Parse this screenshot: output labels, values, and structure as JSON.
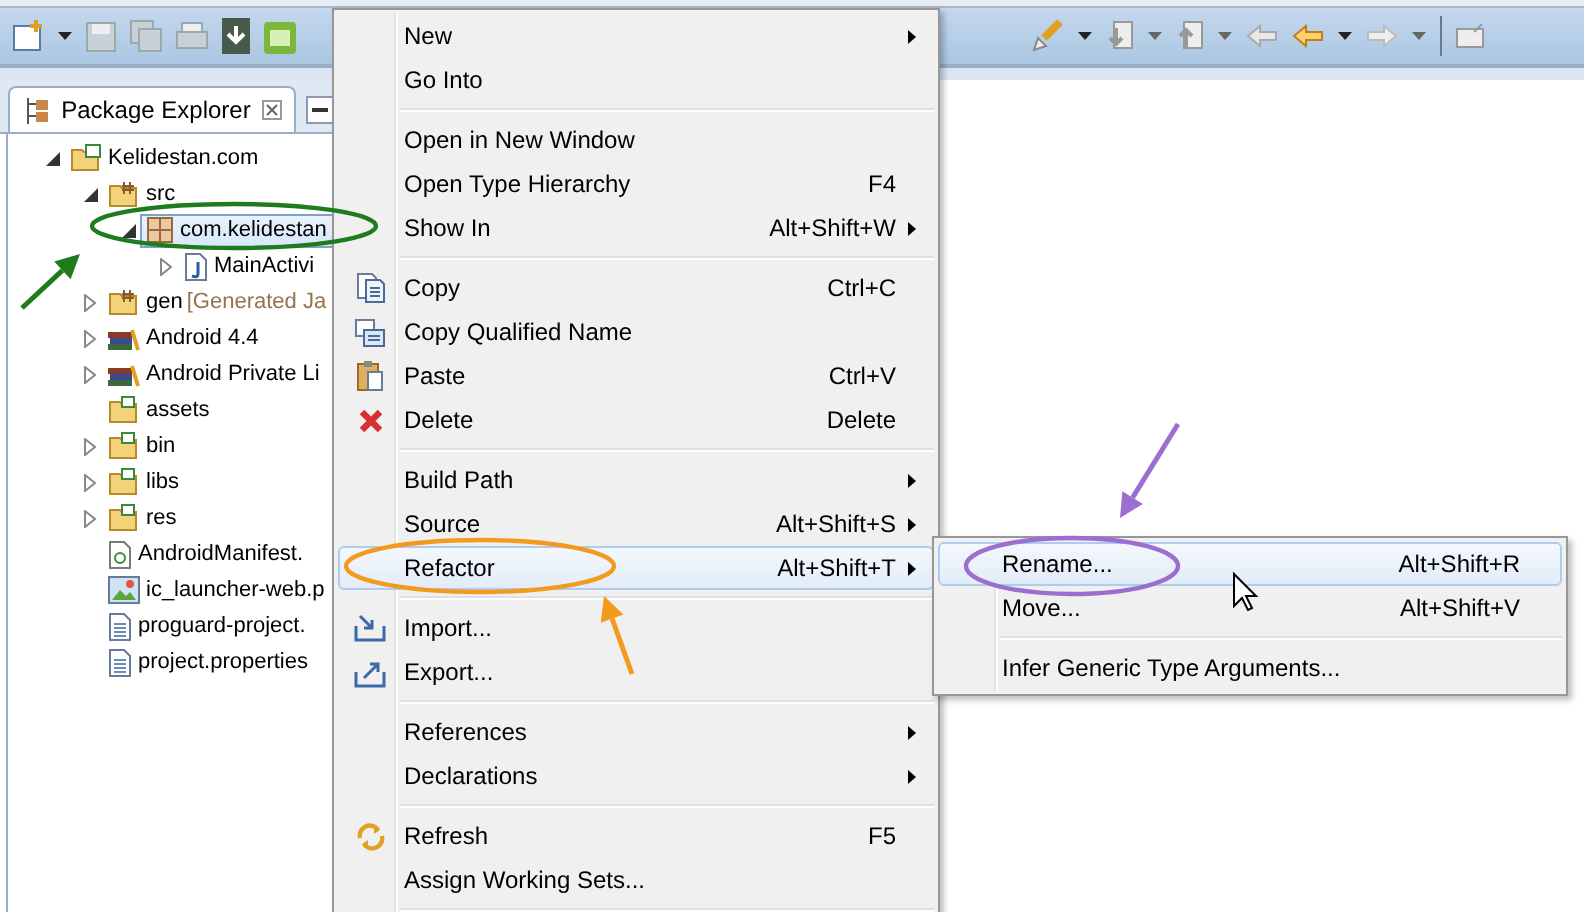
{
  "package_explorer": {
    "tab_label": "Package Explorer",
    "tree": [
      {
        "label": "Kelidestan.com",
        "kind": "project",
        "expandable": true,
        "expanded": true,
        "selected": false,
        "children": [
          {
            "label": "src",
            "kind": "source-folder",
            "expandable": true,
            "expanded": true,
            "selected": false,
            "children": [
              {
                "label": "com.kelidestan",
                "kind": "package",
                "expandable": true,
                "expanded": true,
                "selected": true,
                "children": [
                  {
                    "label": "MainActivi",
                    "kind": "java-file",
                    "expandable": true,
                    "expanded": false,
                    "selected": false
                  }
                ]
              }
            ]
          },
          {
            "label": "gen",
            "decoration": "[Generated Ja",
            "kind": "source-folder",
            "expandable": true,
            "expanded": false,
            "selected": false
          },
          {
            "label": "Android 4.4",
            "kind": "library",
            "expandable": true,
            "expanded": false,
            "selected": false
          },
          {
            "label": "Android Private Li",
            "kind": "library",
            "expandable": true,
            "expanded": false,
            "selected": false
          },
          {
            "label": "assets",
            "kind": "folder",
            "expandable": false,
            "selected": false
          },
          {
            "label": "bin",
            "kind": "folder",
            "expandable": true,
            "expanded": false,
            "selected": false
          },
          {
            "label": "libs",
            "kind": "folder",
            "expandable": true,
            "expanded": false,
            "selected": false
          },
          {
            "label": "res",
            "kind": "folder",
            "expandable": true,
            "expanded": false,
            "selected": false
          },
          {
            "label": "AndroidManifest.",
            "kind": "xml-file",
            "expandable": false,
            "selected": false
          },
          {
            "label": "ic_launcher-web.p",
            "kind": "image-file",
            "expandable": false,
            "selected": false
          },
          {
            "label": "proguard-project.",
            "kind": "text-file",
            "expandable": false,
            "selected": false
          },
          {
            "label": "project.properties",
            "kind": "text-file",
            "expandable": false,
            "selected": false
          }
        ]
      }
    ]
  },
  "context_menu": {
    "items": [
      {
        "kind": "plain",
        "label": "New",
        "submenu": true,
        "selected": false
      },
      {
        "kind": "plain",
        "label": "Go Into",
        "submenu": false,
        "selected": false
      },
      {
        "kind": "separator"
      },
      {
        "kind": "plain",
        "label": "Open in New Window",
        "submenu": false,
        "selected": false
      },
      {
        "kind": "plain",
        "label": "Open Type Hierarchy",
        "shortcut": "F4",
        "submenu": false,
        "selected": false
      },
      {
        "kind": "plain",
        "label": "Show In",
        "shortcut": "Alt+Shift+W",
        "submenu": true,
        "selected": false
      },
      {
        "kind": "separator"
      },
      {
        "kind": "copy",
        "label": "Copy",
        "shortcut": "Ctrl+C",
        "submenu": false,
        "selected": false
      },
      {
        "kind": "copy-name",
        "label": "Copy Qualified Name",
        "submenu": false,
        "selected": false
      },
      {
        "kind": "paste",
        "label": "Paste",
        "shortcut": "Ctrl+V",
        "submenu": false,
        "selected": false
      },
      {
        "kind": "delete",
        "label": "Delete",
        "shortcut": "Delete",
        "submenu": false,
        "selected": false
      },
      {
        "kind": "separator"
      },
      {
        "kind": "plain",
        "label": "Build Path",
        "submenu": true,
        "selected": false
      },
      {
        "kind": "plain",
        "label": "Source",
        "shortcut": "Alt+Shift+S",
        "submenu": true,
        "selected": false
      },
      {
        "kind": "plain",
        "label": "Refactor",
        "shortcut": "Alt+Shift+T",
        "submenu": true,
        "selected": true
      },
      {
        "kind": "separator"
      },
      {
        "kind": "import",
        "label": "Import...",
        "submenu": false,
        "selected": false
      },
      {
        "kind": "export",
        "label": "Export...",
        "submenu": false,
        "selected": false
      },
      {
        "kind": "separator"
      },
      {
        "kind": "plain",
        "label": "References",
        "submenu": true,
        "selected": false
      },
      {
        "kind": "plain",
        "label": "Declarations",
        "submenu": true,
        "selected": false
      },
      {
        "kind": "separator"
      },
      {
        "kind": "refresh",
        "label": "Refresh",
        "shortcut": "F5",
        "submenu": false,
        "selected": false
      },
      {
        "kind": "plain",
        "label": "Assign Working Sets...",
        "submenu": false,
        "selected": false
      },
      {
        "kind": "separator"
      }
    ]
  },
  "refactor_submenu": {
    "items": [
      {
        "kind": "plain",
        "label": "Rename...",
        "shortcut": "Alt+Shift+R",
        "submenu": false,
        "selected": true
      },
      {
        "kind": "plain",
        "label": "Move...",
        "shortcut": "Alt+Shift+V",
        "submenu": false,
        "selected": false
      },
      {
        "kind": "separator"
      },
      {
        "kind": "plain",
        "label": "Infer Generic Type Arguments...",
        "submenu": false,
        "selected": false
      }
    ]
  },
  "annotations": [
    {
      "kind": "ellipse",
      "color": "#1e7b1e"
    },
    {
      "kind": "arrow",
      "color": "#1e7b1e"
    },
    {
      "kind": "ellipse",
      "color": "#f39a1e"
    },
    {
      "kind": "arrow",
      "color": "#f39a1e"
    },
    {
      "kind": "ellipse",
      "color": "#9b6fcf"
    },
    {
      "kind": "arrow",
      "color": "#9b6fcf"
    }
  ]
}
